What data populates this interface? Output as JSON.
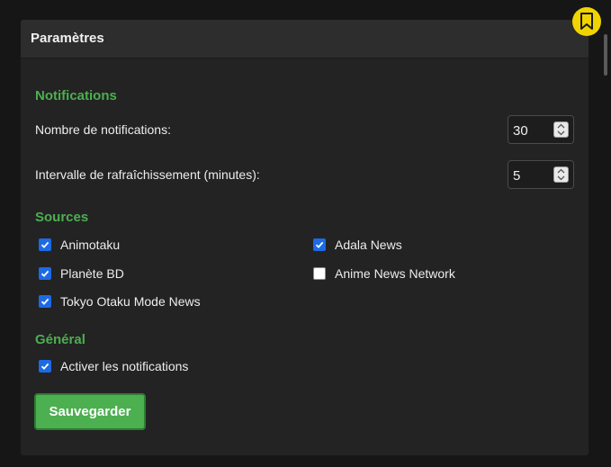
{
  "panel": {
    "title": "Paramètres"
  },
  "notifications": {
    "heading": "Notifications",
    "count_label": "Nombre de notifications:",
    "count_value": "30",
    "interval_label": "Intervalle de rafraîchissement (minutes):",
    "interval_value": "5"
  },
  "sources": {
    "heading": "Sources",
    "items": [
      {
        "label": "Animotaku",
        "checked": true
      },
      {
        "label": "Adala News",
        "checked": true
      },
      {
        "label": "Planète BD",
        "checked": true
      },
      {
        "label": "Anime News Network",
        "checked": false
      },
      {
        "label": "Tokyo Otaku Mode News",
        "checked": true
      }
    ]
  },
  "general": {
    "heading": "Général",
    "enable_label": "Activer les notifications",
    "enable_checked": true
  },
  "actions": {
    "save_label": "Sauvegarder"
  },
  "icons": {
    "bookmark": "bookmark-icon",
    "checkbox_checked": "checkmark-icon",
    "spinner_up": "chevron-up-icon",
    "spinner_down": "chevron-down-icon"
  },
  "colors": {
    "accent_green": "#4caf50",
    "checkbox_blue": "#1d6ae5",
    "bookmark_yellow": "#f0d400",
    "panel_bg": "#232323",
    "header_bg": "#2d2d2d"
  }
}
